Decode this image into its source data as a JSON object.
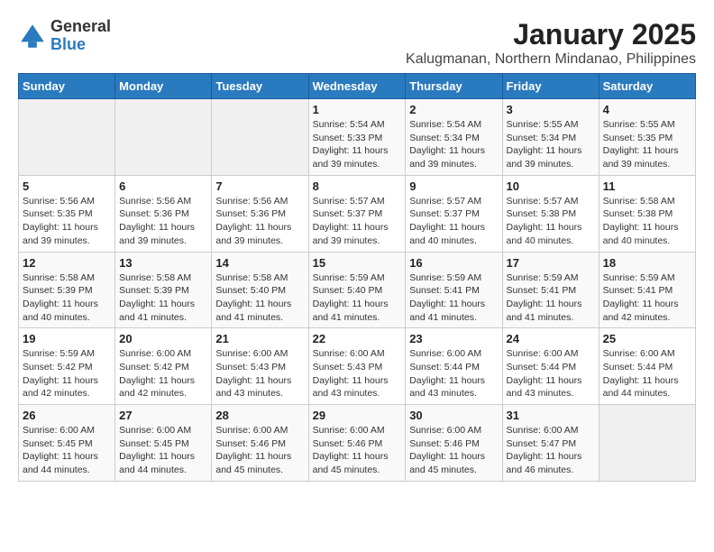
{
  "logo": {
    "text_general": "General",
    "text_blue": "Blue"
  },
  "title": "January 2025",
  "subtitle": "Kalugmanan, Northern Mindanao, Philippines",
  "weekdays": [
    "Sunday",
    "Monday",
    "Tuesday",
    "Wednesday",
    "Thursday",
    "Friday",
    "Saturday"
  ],
  "weeks": [
    [
      {
        "day": "",
        "sunrise": "",
        "sunset": "",
        "daylight": ""
      },
      {
        "day": "",
        "sunrise": "",
        "sunset": "",
        "daylight": ""
      },
      {
        "day": "",
        "sunrise": "",
        "sunset": "",
        "daylight": ""
      },
      {
        "day": "1",
        "sunrise": "Sunrise: 5:54 AM",
        "sunset": "Sunset: 5:33 PM",
        "daylight": "Daylight: 11 hours and 39 minutes."
      },
      {
        "day": "2",
        "sunrise": "Sunrise: 5:54 AM",
        "sunset": "Sunset: 5:34 PM",
        "daylight": "Daylight: 11 hours and 39 minutes."
      },
      {
        "day": "3",
        "sunrise": "Sunrise: 5:55 AM",
        "sunset": "Sunset: 5:34 PM",
        "daylight": "Daylight: 11 hours and 39 minutes."
      },
      {
        "day": "4",
        "sunrise": "Sunrise: 5:55 AM",
        "sunset": "Sunset: 5:35 PM",
        "daylight": "Daylight: 11 hours and 39 minutes."
      }
    ],
    [
      {
        "day": "5",
        "sunrise": "Sunrise: 5:56 AM",
        "sunset": "Sunset: 5:35 PM",
        "daylight": "Daylight: 11 hours and 39 minutes."
      },
      {
        "day": "6",
        "sunrise": "Sunrise: 5:56 AM",
        "sunset": "Sunset: 5:36 PM",
        "daylight": "Daylight: 11 hours and 39 minutes."
      },
      {
        "day": "7",
        "sunrise": "Sunrise: 5:56 AM",
        "sunset": "Sunset: 5:36 PM",
        "daylight": "Daylight: 11 hours and 39 minutes."
      },
      {
        "day": "8",
        "sunrise": "Sunrise: 5:57 AM",
        "sunset": "Sunset: 5:37 PM",
        "daylight": "Daylight: 11 hours and 39 minutes."
      },
      {
        "day": "9",
        "sunrise": "Sunrise: 5:57 AM",
        "sunset": "Sunset: 5:37 PM",
        "daylight": "Daylight: 11 hours and 40 minutes."
      },
      {
        "day": "10",
        "sunrise": "Sunrise: 5:57 AM",
        "sunset": "Sunset: 5:38 PM",
        "daylight": "Daylight: 11 hours and 40 minutes."
      },
      {
        "day": "11",
        "sunrise": "Sunrise: 5:58 AM",
        "sunset": "Sunset: 5:38 PM",
        "daylight": "Daylight: 11 hours and 40 minutes."
      }
    ],
    [
      {
        "day": "12",
        "sunrise": "Sunrise: 5:58 AM",
        "sunset": "Sunset: 5:39 PM",
        "daylight": "Daylight: 11 hours and 40 minutes."
      },
      {
        "day": "13",
        "sunrise": "Sunrise: 5:58 AM",
        "sunset": "Sunset: 5:39 PM",
        "daylight": "Daylight: 11 hours and 41 minutes."
      },
      {
        "day": "14",
        "sunrise": "Sunrise: 5:58 AM",
        "sunset": "Sunset: 5:40 PM",
        "daylight": "Daylight: 11 hours and 41 minutes."
      },
      {
        "day": "15",
        "sunrise": "Sunrise: 5:59 AM",
        "sunset": "Sunset: 5:40 PM",
        "daylight": "Daylight: 11 hours and 41 minutes."
      },
      {
        "day": "16",
        "sunrise": "Sunrise: 5:59 AM",
        "sunset": "Sunset: 5:41 PM",
        "daylight": "Daylight: 11 hours and 41 minutes."
      },
      {
        "day": "17",
        "sunrise": "Sunrise: 5:59 AM",
        "sunset": "Sunset: 5:41 PM",
        "daylight": "Daylight: 11 hours and 41 minutes."
      },
      {
        "day": "18",
        "sunrise": "Sunrise: 5:59 AM",
        "sunset": "Sunset: 5:41 PM",
        "daylight": "Daylight: 11 hours and 42 minutes."
      }
    ],
    [
      {
        "day": "19",
        "sunrise": "Sunrise: 5:59 AM",
        "sunset": "Sunset: 5:42 PM",
        "daylight": "Daylight: 11 hours and 42 minutes."
      },
      {
        "day": "20",
        "sunrise": "Sunrise: 6:00 AM",
        "sunset": "Sunset: 5:42 PM",
        "daylight": "Daylight: 11 hours and 42 minutes."
      },
      {
        "day": "21",
        "sunrise": "Sunrise: 6:00 AM",
        "sunset": "Sunset: 5:43 PM",
        "daylight": "Daylight: 11 hours and 43 minutes."
      },
      {
        "day": "22",
        "sunrise": "Sunrise: 6:00 AM",
        "sunset": "Sunset: 5:43 PM",
        "daylight": "Daylight: 11 hours and 43 minutes."
      },
      {
        "day": "23",
        "sunrise": "Sunrise: 6:00 AM",
        "sunset": "Sunset: 5:44 PM",
        "daylight": "Daylight: 11 hours and 43 minutes."
      },
      {
        "day": "24",
        "sunrise": "Sunrise: 6:00 AM",
        "sunset": "Sunset: 5:44 PM",
        "daylight": "Daylight: 11 hours and 43 minutes."
      },
      {
        "day": "25",
        "sunrise": "Sunrise: 6:00 AM",
        "sunset": "Sunset: 5:44 PM",
        "daylight": "Daylight: 11 hours and 44 minutes."
      }
    ],
    [
      {
        "day": "26",
        "sunrise": "Sunrise: 6:00 AM",
        "sunset": "Sunset: 5:45 PM",
        "daylight": "Daylight: 11 hours and 44 minutes."
      },
      {
        "day": "27",
        "sunrise": "Sunrise: 6:00 AM",
        "sunset": "Sunset: 5:45 PM",
        "daylight": "Daylight: 11 hours and 44 minutes."
      },
      {
        "day": "28",
        "sunrise": "Sunrise: 6:00 AM",
        "sunset": "Sunset: 5:46 PM",
        "daylight": "Daylight: 11 hours and 45 minutes."
      },
      {
        "day": "29",
        "sunrise": "Sunrise: 6:00 AM",
        "sunset": "Sunset: 5:46 PM",
        "daylight": "Daylight: 11 hours and 45 minutes."
      },
      {
        "day": "30",
        "sunrise": "Sunrise: 6:00 AM",
        "sunset": "Sunset: 5:46 PM",
        "daylight": "Daylight: 11 hours and 45 minutes."
      },
      {
        "day": "31",
        "sunrise": "Sunrise: 6:00 AM",
        "sunset": "Sunset: 5:47 PM",
        "daylight": "Daylight: 11 hours and 46 minutes."
      },
      {
        "day": "",
        "sunrise": "",
        "sunset": "",
        "daylight": ""
      }
    ]
  ]
}
